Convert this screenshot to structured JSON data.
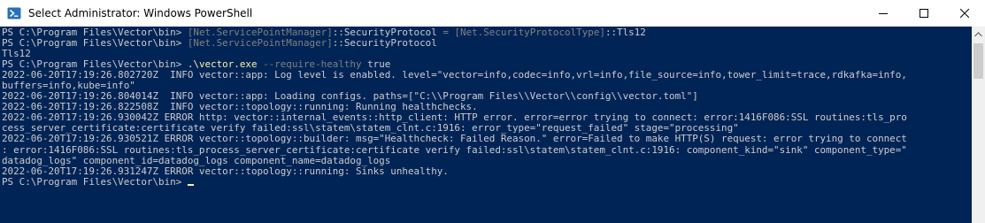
{
  "window": {
    "title": "Select Administrator: Windows PowerShell"
  },
  "console": {
    "lines": [
      {
        "segments": [
          {
            "cls": "c-prompt",
            "text": "PS C:\\Program Files\\Vector\\bin> "
          },
          {
            "cls": "c-type",
            "text": "[Net.ServicePointManager]"
          },
          {
            "cls": "c-text",
            "text": "::SecurityProtocol "
          },
          {
            "cls": "c-op",
            "text": "="
          },
          {
            "cls": "c-text",
            "text": " "
          },
          {
            "cls": "c-type",
            "text": "[Net.SecurityProtocolType]"
          },
          {
            "cls": "c-text",
            "text": "::Tls12"
          }
        ]
      },
      {
        "segments": [
          {
            "cls": "c-prompt",
            "text": "PS C:\\Program Files\\Vector\\bin> "
          },
          {
            "cls": "c-type",
            "text": "[Net.ServicePointManager]"
          },
          {
            "cls": "c-text",
            "text": "::SecurityProtocol"
          }
        ]
      },
      {
        "segments": [
          {
            "cls": "c-text",
            "text": "Tls12"
          }
        ]
      },
      {
        "segments": [
          {
            "cls": "c-prompt",
            "text": "PS C:\\Program Files\\Vector\\bin> "
          },
          {
            "cls": "c-cmd",
            "text": ".\\vector.exe"
          },
          {
            "cls": "c-text",
            "text": " "
          },
          {
            "cls": "c-param",
            "text": "--require-healthy"
          },
          {
            "cls": "c-text",
            "text": " true"
          }
        ]
      },
      {
        "segments": [
          {
            "cls": "c-text",
            "text": "2022-06-20T17:19:26.802720Z  INFO vector::app: Log level is enabled. level=\"vector=info,codec=info,vrl=info,file_source=info,tower_limit=trace,rdkafka=info,"
          }
        ]
      },
      {
        "segments": [
          {
            "cls": "c-text",
            "text": "buffers=info,kube=info\""
          }
        ]
      },
      {
        "segments": [
          {
            "cls": "c-text",
            "text": "2022-06-20T17:19:26.804014Z  INFO vector::app: Loading configs. paths=[\"C:\\\\Program Files\\\\Vector\\\\config\\\\vector.toml\"]"
          }
        ]
      },
      {
        "segments": [
          {
            "cls": "c-text",
            "text": "2022-06-20T17:19:26.822508Z  INFO vector::topology::running: Running healthchecks."
          }
        ]
      },
      {
        "segments": [
          {
            "cls": "c-text",
            "text": "2022-06-20T17:19:26.930042Z ERROR http: vector::internal_events::http_client: HTTP error. error=error trying to connect: error:1416F086:SSL routines:tls_pro"
          }
        ]
      },
      {
        "segments": [
          {
            "cls": "c-text",
            "text": "cess_server_certificate:certificate verify failed:ssl\\statem\\statem_clnt.c:1916: error_type=\"request_failed\" stage=\"processing\""
          }
        ]
      },
      {
        "segments": [
          {
            "cls": "c-text",
            "text": "2022-06-20T17:19:26.930521Z ERROR vector::topology::builder: msg=\"Healthcheck: Failed Reason.\" error=Failed to make HTTP(S) request: error trying to connect"
          }
        ]
      },
      {
        "segments": [
          {
            "cls": "c-text",
            "text": ": error:1416F086:SSL routines:tls_process_server_certificate:certificate verify failed:ssl\\statem\\statem_clnt.c:1916: component_kind=\"sink\" component_type=\""
          }
        ]
      },
      {
        "segments": [
          {
            "cls": "c-text",
            "text": "datadog_logs\" component_id=datadog_logs component_name=datadog_logs"
          }
        ]
      },
      {
        "segments": [
          {
            "cls": "c-text",
            "text": "2022-06-20T17:19:26.931247Z ERROR vector::topology::running: Sinks unhealthy."
          }
        ]
      },
      {
        "segments": [
          {
            "cls": "c-prompt",
            "text": "PS C:\\Program Files\\Vector\\bin> "
          }
        ],
        "cursor": true
      }
    ]
  },
  "colors": {
    "background": "#012456",
    "text": "#cccccc",
    "command": "#f9f1a5",
    "muted": "#808080"
  },
  "icons": {
    "app": "powershell-icon",
    "minimize": "minimize-icon",
    "maximize": "maximize-icon",
    "close": "close-icon",
    "scroll_up": "scroll-up-arrow-icon"
  }
}
